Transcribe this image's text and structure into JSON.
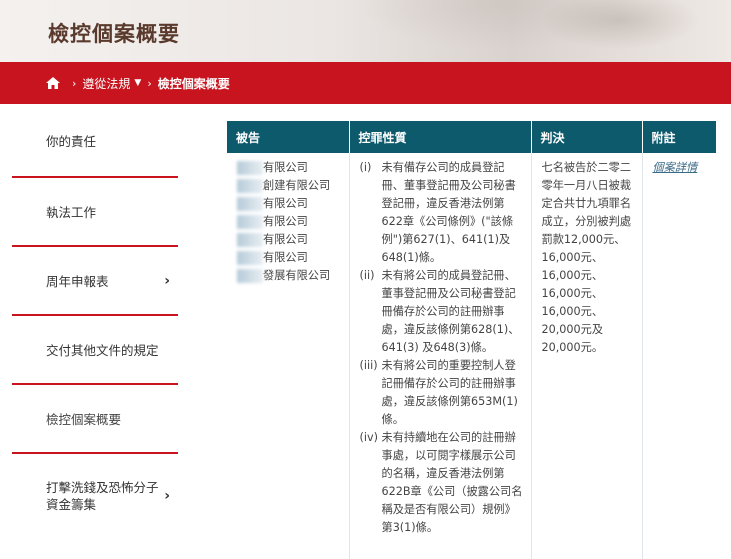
{
  "header": {
    "title": "檢控個案概要"
  },
  "breadcrumb": {
    "items": [
      "遵從法規",
      "檢控個案概要"
    ]
  },
  "sidebar": {
    "items": [
      {
        "label": "你的責任",
        "arrow": ""
      },
      {
        "label": "執法工作",
        "arrow": ""
      },
      {
        "label": "周年申報表",
        "arrow": "›"
      },
      {
        "label": "交付其他文件的規定",
        "arrow": ""
      },
      {
        "label": "檢控個案概要",
        "arrow": ""
      },
      {
        "label": "打擊洗錢及恐怖分子資金籌集",
        "arrow": "›"
      }
    ]
  },
  "table": {
    "headers": [
      "被告",
      "控罪性質",
      "判決",
      "附註"
    ],
    "defendants": [
      "有限公司",
      "創建有限公司",
      "有限公司",
      "有限公司",
      "有限公司",
      "有限公司",
      "發展有限公司"
    ],
    "charges": [
      {
        "num": "(i)",
        "text": "未有備存公司的成員登記冊、董事登記冊及公司秘書登記冊，違反香港法例第622章《公司條例》(\"該條例\")第627(1)、641(1)及648(1)條。"
      },
      {
        "num": "(ii)",
        "text": "未有將公司的成員登記冊、董事登記冊及公司秘書登記冊備存於公司的註冊辦事處，違反該條例第628(1)、641(3) 及648(3)條。"
      },
      {
        "num": "(iii)",
        "text": "未有將公司的重要控制人登記冊備存於公司的註冊辦事處，違反該條例第653M(1)條。"
      },
      {
        "num": "(iv)",
        "text": "未有持續地在公司的註冊辦事處，以可閱字樣展示公司的名稱，違反香港法例第622B章《公司（披露公司名稱及是否有限公司）規例》第3(1)條。"
      }
    ],
    "judgement": "七名被告於二零二零年一月八日被裁定合共廿九項罪名成立，分別被判處罰款12,000元、16,000元、16,000元、16,000元、16,000元、20,000元及20,000元。",
    "remark_link": "個案詳情"
  }
}
